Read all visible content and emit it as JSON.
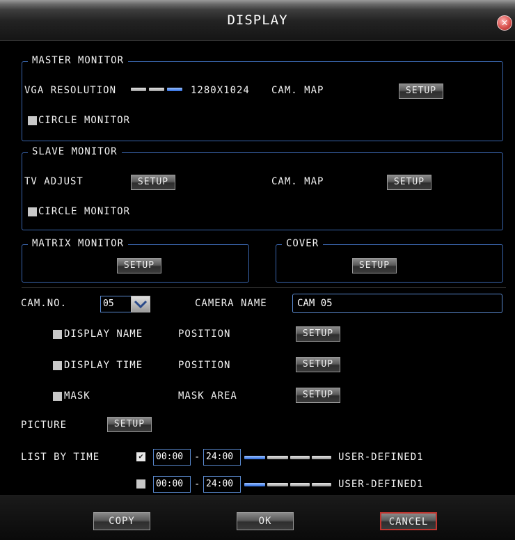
{
  "window": {
    "title": "DISPLAY"
  },
  "master": {
    "legend": "MASTER MONITOR",
    "vga_label": "VGA RESOLUTION",
    "vga_value": "1280X1024",
    "vga_level": 3,
    "vga_levels": 3,
    "cam_map_label": "CAM. MAP",
    "cam_map_button": "SETUP",
    "circle_label": "CIRCLE MONITOR"
  },
  "slave": {
    "legend": "SLAVE MONITOR",
    "tv_adjust_label": "TV ADJUST",
    "tv_adjust_button": "SETUP",
    "cam_map_label": "CAM. MAP",
    "cam_map_button": "SETUP",
    "circle_label": "CIRCLE MONITOR"
  },
  "matrix": {
    "legend": "MATRIX MONITOR",
    "button": "SETUP"
  },
  "cover": {
    "legend": "COVER",
    "button": "SETUP"
  },
  "camera": {
    "cam_no_label": "CAM.NO.",
    "cam_no_value": "05",
    "name_label": "CAMERA NAME",
    "name_value": "CAM 05"
  },
  "options": {
    "display_name_label": "DISPLAY NAME",
    "display_name_pos_label": "POSITION",
    "display_name_button": "SETUP",
    "display_time_label": "DISPLAY TIME",
    "display_time_pos_label": "POSITION",
    "display_time_button": "SETUP",
    "mask_label": "MASK",
    "mask_area_label": "MASK AREA",
    "mask_button": "SETUP"
  },
  "picture": {
    "label": "PICTURE",
    "button": "SETUP"
  },
  "list_by_time": {
    "label": "LIST BY TIME",
    "rows": [
      {
        "checked": true,
        "check_mark": "✔",
        "start": "00:00",
        "end": "24:00",
        "dash": "-",
        "mode": "USER-DEFINED1",
        "level": 1
      },
      {
        "checked": false,
        "check_mark": "",
        "start": "00:00",
        "end": "24:00",
        "dash": "-",
        "mode": "USER-DEFINED1",
        "level": 1
      }
    ]
  },
  "footer": {
    "copy": "COPY",
    "ok": "OK",
    "cancel": "CANCEL"
  },
  "colors": {
    "border": "#3a66ae",
    "cancel_border": "#c0352f",
    "close": "#d9534f"
  },
  "icons": {
    "close": "close-x-icon",
    "dropdown": "chevron-down-icon",
    "check": "checkmark-icon"
  }
}
